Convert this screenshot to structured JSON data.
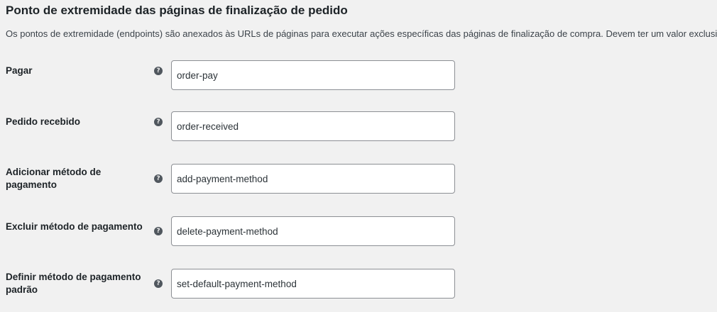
{
  "section": {
    "title": "Ponto de extremidade das páginas de finalização de pedido",
    "description": "Os pontos de extremidade (endpoints) são anexados às URLs de páginas para executar ações específicas das páginas de finalização de compra. Devem ter um valor exclusivo."
  },
  "help_icon": {
    "name": "question-circle-icon",
    "glyph": "?",
    "color": "#50575e"
  },
  "fields": [
    {
      "label": "Pagar",
      "value": "order-pay"
    },
    {
      "label": "Pedido recebido",
      "value": "order-received"
    },
    {
      "label": "Adicionar método de pagamento",
      "value": "add-payment-method"
    },
    {
      "label": "Excluir método de pagamento",
      "value": "delete-payment-method"
    },
    {
      "label": "Definir método de pagamento padrão",
      "value": "set-default-payment-method"
    }
  ]
}
